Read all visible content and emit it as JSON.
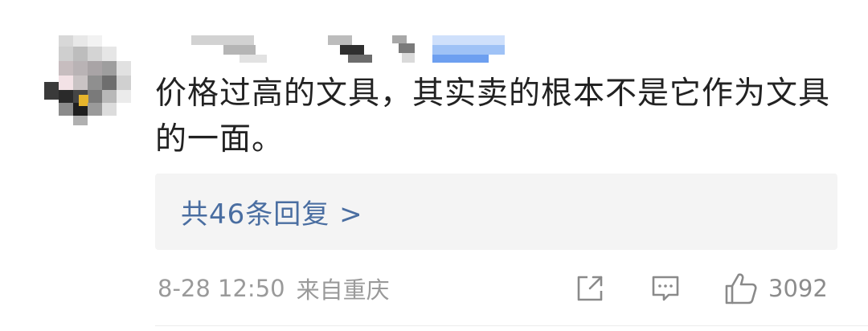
{
  "comment": {
    "text": "价格过高的文具，其实卖的根本不是它作为文具的一面。"
  },
  "replies": {
    "label": "共46条回复 >"
  },
  "meta": {
    "time": "8-28 12:50",
    "location": "来自重庆"
  },
  "actions": {
    "share_icon": "share-icon",
    "comment_icon": "comment-icon",
    "like_icon": "thumbs-up-icon",
    "like_count": "3092"
  },
  "colors": {
    "text": "#222222",
    "link": "#4a6ea1",
    "meta": "#9a9a9a",
    "reply_bg": "#f4f4f4"
  }
}
